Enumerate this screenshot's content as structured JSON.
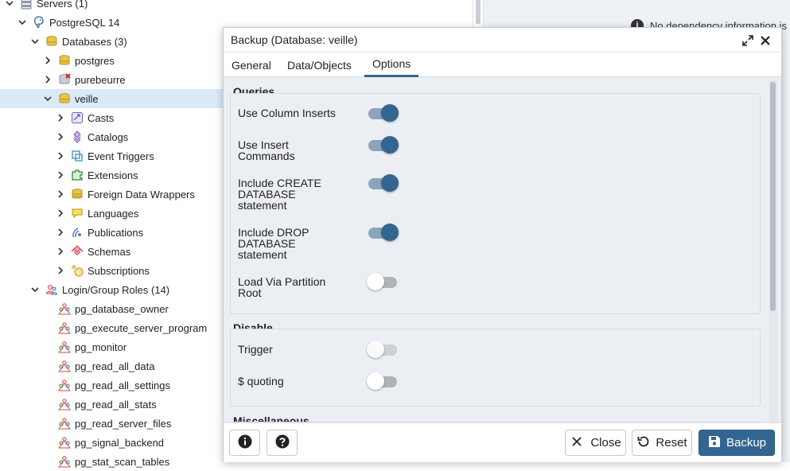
{
  "tree": {
    "items": [
      {
        "label": "Servers (1)",
        "icon": "servers-icon",
        "expanded": true
      },
      {
        "label": "PostgreSQL 14",
        "icon": "postgresql-elephant-icon",
        "expanded": true
      },
      {
        "label": "Databases (3)",
        "icon": "databases-icon",
        "expanded": true
      },
      {
        "label": "postgres",
        "icon": "database-icon",
        "expanded": false
      },
      {
        "label": "purebeurre",
        "icon": "database-disconnected-icon",
        "expanded": false
      },
      {
        "label": "veille",
        "icon": "database-icon",
        "expanded": true,
        "selected": true
      },
      {
        "label": "Casts",
        "icon": "casts-icon",
        "expanded": false
      },
      {
        "label": "Catalogs",
        "icon": "catalogs-icon",
        "expanded": false
      },
      {
        "label": "Event Triggers",
        "icon": "event-triggers-icon",
        "expanded": false
      },
      {
        "label": "Extensions",
        "icon": "extensions-icon",
        "expanded": false
      },
      {
        "label": "Foreign Data Wrappers",
        "icon": "foreign-data-wrappers-icon",
        "expanded": false
      },
      {
        "label": "Languages",
        "icon": "languages-icon",
        "expanded": false
      },
      {
        "label": "Publications",
        "icon": "publications-icon",
        "expanded": false
      },
      {
        "label": "Schemas",
        "icon": "schemas-icon",
        "expanded": false
      },
      {
        "label": "Subscriptions",
        "icon": "subscriptions-icon",
        "expanded": false
      },
      {
        "label": "Login/Group Roles (14)",
        "icon": "login-group-roles-icon",
        "expanded": true
      },
      {
        "label": "pg_database_owner",
        "icon": "group-role-icon"
      },
      {
        "label": "pg_execute_server_program",
        "icon": "group-role-icon"
      },
      {
        "label": "pg_monitor",
        "icon": "group-role-icon"
      },
      {
        "label": "pg_read_all_data",
        "icon": "group-role-icon"
      },
      {
        "label": "pg_read_all_settings",
        "icon": "group-role-icon"
      },
      {
        "label": "pg_read_all_stats",
        "icon": "group-role-icon"
      },
      {
        "label": "pg_read_server_files",
        "icon": "group-role-icon"
      },
      {
        "label": "pg_signal_backend",
        "icon": "group-role-icon"
      },
      {
        "label": "pg_stat_scan_tables",
        "icon": "group-role-icon"
      }
    ]
  },
  "right_panel": {
    "dependency_info": "No dependency information is"
  },
  "dialog": {
    "title": "Backup (Database: veille)",
    "tabs": [
      {
        "label": "General",
        "active": false
      },
      {
        "label": "Data/Objects",
        "active": false
      },
      {
        "label": "Options",
        "active": true
      }
    ],
    "sections": {
      "queries": {
        "title": "Queries",
        "options": [
          {
            "label": "Use Column Inserts",
            "enabled": true
          },
          {
            "label": "Use Insert Commands",
            "enabled": true
          },
          {
            "label": "Include CREATE DATABASE statement",
            "enabled": true
          },
          {
            "label": "Include DROP DATABASE statement",
            "enabled": true
          },
          {
            "label": "Load Via Partition Root",
            "enabled": false
          }
        ]
      },
      "disable": {
        "title": "Disable",
        "options": [
          {
            "label": "Trigger",
            "enabled": false,
            "disabled": true
          },
          {
            "label": "$ quoting",
            "enabled": false
          }
        ]
      },
      "miscellaneous": {
        "title": "Miscellaneous"
      }
    },
    "footer": {
      "info_icon": "info-circle-icon",
      "help_icon": "help-circle-icon",
      "close_label": "Close",
      "reset_label": "Reset",
      "backup_label": "Backup"
    }
  },
  "colors": {
    "accent": "#326690",
    "selected_row": "#dbeaf7",
    "dialog_bg": "#ebeef3"
  }
}
